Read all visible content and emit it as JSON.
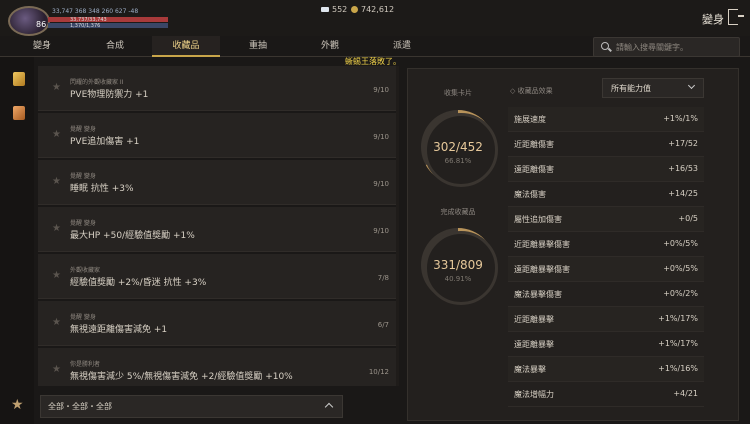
{
  "player": {
    "level": "86",
    "stats_line": "33,747   368   348   260   627   -48",
    "hp_text": "33,737/33,743",
    "mp_text": "1,370/1,376"
  },
  "currency": {
    "diamonds": "552",
    "gold": "742,612"
  },
  "page_title": "變身",
  "tabs": [
    {
      "label": "變身"
    },
    {
      "label": "合成"
    },
    {
      "label": "收藏品"
    },
    {
      "label": "重抽"
    },
    {
      "label": "外觀"
    },
    {
      "label": "派遣"
    }
  ],
  "active_tab": "收藏品",
  "search": {
    "placeholder": "請輸入搜尋關鍵字。"
  },
  "notice": "蜥蜴王落敗了。",
  "collections": [
    {
      "category": "閃耀的外觀收藏家 II",
      "effect": "PVE物理防禦力 +1",
      "count": "9/10"
    },
    {
      "category": "覺醒 變身",
      "effect": "PVE追加傷害 +1",
      "count": "9/10"
    },
    {
      "category": "覺醒 變身",
      "effect": "睡眠 抗性 +3%",
      "count": "9/10"
    },
    {
      "category": "覺醒 變身",
      "effect": "最大HP +50/經驗值獎勵 +1%",
      "count": "9/10"
    },
    {
      "category": "外觀收藏家",
      "effect": "經驗值獎勵 +2%/昏迷 抗性 +3%",
      "count": "7/8"
    },
    {
      "category": "覺醒 變身",
      "effect": "無視遠距離傷害減免 +1",
      "count": "6/7"
    },
    {
      "category": "你是勝利者",
      "effect": "無視傷害減少 5%/無視傷害減免 +2/經驗值獎勵 +10%",
      "count": "10/12"
    }
  ],
  "filter": {
    "label": "全部・全部・全部"
  },
  "gauges": {
    "cards": {
      "label": "收集卡片",
      "value": "302/452",
      "percent": "66.81%",
      "fraction": 0.668
    },
    "completed": {
      "label": "完成收藏品",
      "value": "331/809",
      "percent": "40.91%",
      "fraction": 0.409
    }
  },
  "effects_panel": {
    "label": "收藏品效果",
    "dropdown": "所有能力值",
    "rows": [
      {
        "name": "施展速度",
        "value": "+1%/1%"
      },
      {
        "name": "近距離傷害",
        "value": "+17/52"
      },
      {
        "name": "遠距離傷害",
        "value": "+16/53"
      },
      {
        "name": "魔法傷害",
        "value": "+14/25"
      },
      {
        "name": "屬性追加傷害",
        "value": "+0/5"
      },
      {
        "name": "近距離暴擊傷害",
        "value": "+0%/5%"
      },
      {
        "name": "遠距離暴擊傷害",
        "value": "+0%/5%"
      },
      {
        "name": "魔法暴擊傷害",
        "value": "+0%/2%"
      },
      {
        "name": "近距離暴擊",
        "value": "+1%/17%"
      },
      {
        "name": "遠距離暴擊",
        "value": "+1%/17%"
      },
      {
        "name": "魔法暴擊",
        "value": "+1%/16%"
      },
      {
        "name": "魔法增幅力",
        "value": "+4/21"
      }
    ]
  },
  "colors": {
    "accent": "#c9a64a",
    "notice": "#f2d34a",
    "gauge": "#b8935a"
  }
}
